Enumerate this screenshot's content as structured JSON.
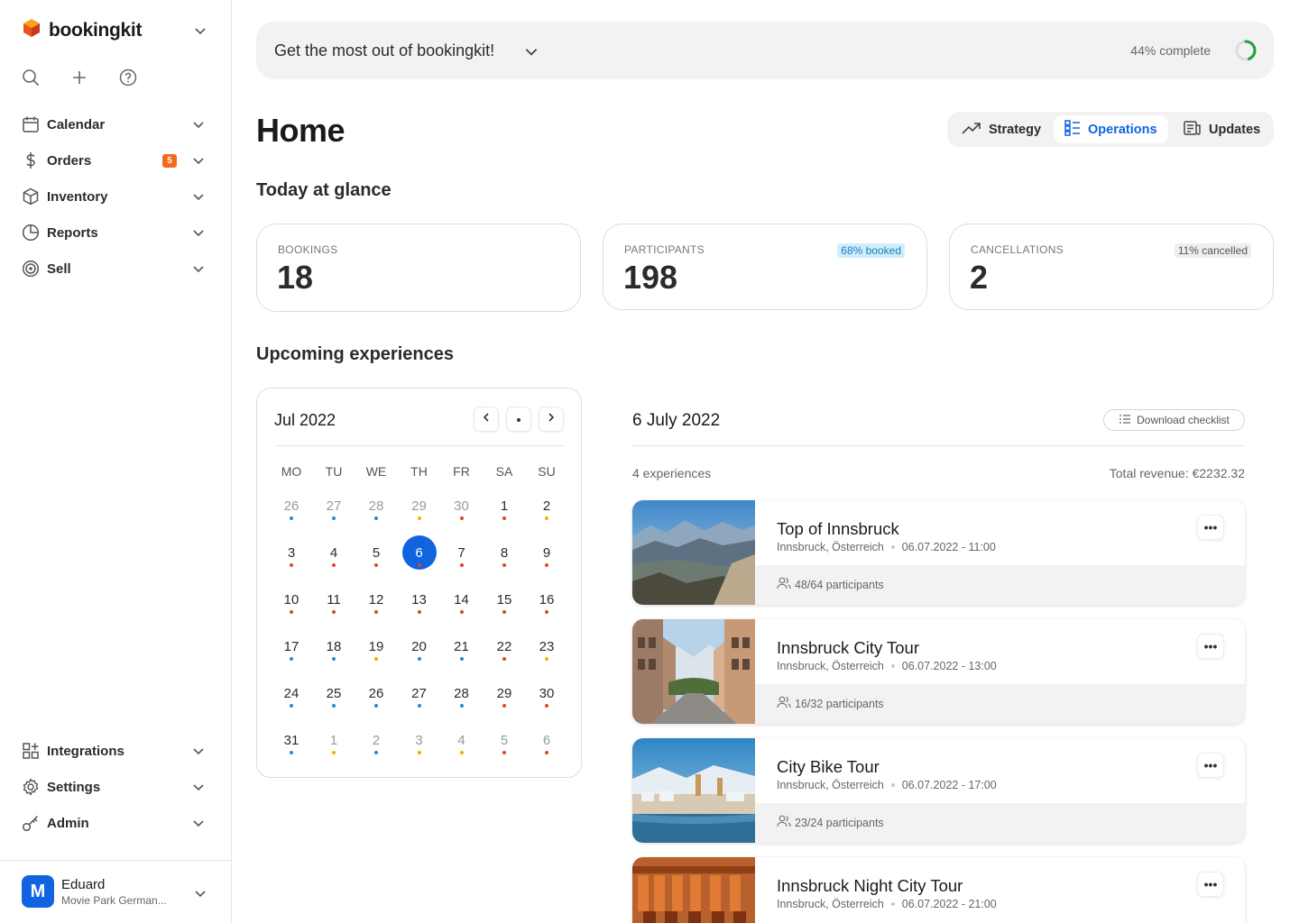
{
  "brand": {
    "name": "bookingkit"
  },
  "sidebar": {
    "top_items": [
      {
        "label": "Calendar",
        "icon": "calendar-icon"
      },
      {
        "label": "Orders",
        "icon": "dollar-icon",
        "badge": "5"
      },
      {
        "label": "Inventory",
        "icon": "box-icon"
      },
      {
        "label": "Reports",
        "icon": "pie-chart-icon"
      },
      {
        "label": "Sell",
        "icon": "target-icon"
      }
    ],
    "bottom_items": [
      {
        "label": "Integrations",
        "icon": "grid-plus-icon"
      },
      {
        "label": "Settings",
        "icon": "gear-icon"
      },
      {
        "label": "Admin",
        "icon": "key-icon"
      }
    ],
    "user": {
      "initial": "M",
      "name": "Eduard",
      "org": "Movie Park German..."
    }
  },
  "banner": {
    "title": "Get the most out of bookingkit!",
    "progress_text": "44% complete",
    "progress": 0.44
  },
  "page": {
    "title": "Home"
  },
  "view_tabs": [
    {
      "label": "Strategy",
      "active": false
    },
    {
      "label": "Operations",
      "active": true
    },
    {
      "label": "Updates",
      "active": false
    }
  ],
  "today": {
    "title": "Today at glance",
    "stats": [
      {
        "label": "BOOKINGS",
        "value": "18",
        "chip": ""
      },
      {
        "label": "PARTICIPANTS",
        "value": "198",
        "chip": "68% booked"
      },
      {
        "label": "CANCELLATIONS",
        "value": "2",
        "chip": "11% cancelled"
      }
    ]
  },
  "upcoming": {
    "title": "Upcoming experiences"
  },
  "calendar": {
    "month": "Jul 2022",
    "weekdays": [
      "MO",
      "TU",
      "WE",
      "TH",
      "FR",
      "SA",
      "SU"
    ],
    "selected": "6",
    "dot_colors": {
      "b": "#1a8fd8",
      "r": "#e0452b",
      "y": "#e8b400"
    },
    "weeks": [
      [
        {
          "d": "26",
          "m": true,
          "dot": "b"
        },
        {
          "d": "27",
          "m": true,
          "dot": "b"
        },
        {
          "d": "28",
          "m": true,
          "dot": "b"
        },
        {
          "d": "29",
          "m": true,
          "dot": "y"
        },
        {
          "d": "30",
          "m": true,
          "dot": "r"
        },
        {
          "d": "1",
          "m": false,
          "dot": "r"
        },
        {
          "d": "2",
          "m": false,
          "dot": "y"
        }
      ],
      [
        {
          "d": "3",
          "m": false,
          "dot": "r"
        },
        {
          "d": "4",
          "m": false,
          "dot": "r"
        },
        {
          "d": "5",
          "m": false,
          "dot": "r"
        },
        {
          "d": "6",
          "m": false,
          "dot": "r"
        },
        {
          "d": "7",
          "m": false,
          "dot": "r"
        },
        {
          "d": "8",
          "m": false,
          "dot": "r"
        },
        {
          "d": "9",
          "m": false,
          "dot": "r"
        }
      ],
      [
        {
          "d": "10",
          "m": false,
          "dot": "r"
        },
        {
          "d": "11",
          "m": false,
          "dot": "r"
        },
        {
          "d": "12",
          "m": false,
          "dot": "r"
        },
        {
          "d": "13",
          "m": false,
          "dot": "r"
        },
        {
          "d": "14",
          "m": false,
          "dot": "r"
        },
        {
          "d": "15",
          "m": false,
          "dot": "r"
        },
        {
          "d": "16",
          "m": false,
          "dot": "r"
        }
      ],
      [
        {
          "d": "17",
          "m": false,
          "dot": "b"
        },
        {
          "d": "18",
          "m": false,
          "dot": "b"
        },
        {
          "d": "19",
          "m": false,
          "dot": "y"
        },
        {
          "d": "20",
          "m": false,
          "dot": "b"
        },
        {
          "d": "21",
          "m": false,
          "dot": "b"
        },
        {
          "d": "22",
          "m": false,
          "dot": "r"
        },
        {
          "d": "23",
          "m": false,
          "dot": "y"
        }
      ],
      [
        {
          "d": "24",
          "m": false,
          "dot": "b"
        },
        {
          "d": "25",
          "m": false,
          "dot": "b"
        },
        {
          "d": "26",
          "m": false,
          "dot": "b"
        },
        {
          "d": "27",
          "m": false,
          "dot": "b"
        },
        {
          "d": "28",
          "m": false,
          "dot": "b"
        },
        {
          "d": "29",
          "m": false,
          "dot": "r"
        },
        {
          "d": "30",
          "m": false,
          "dot": "r"
        }
      ],
      [
        {
          "d": "31",
          "m": false,
          "dot": "b"
        },
        {
          "d": "1",
          "m": true,
          "dot": "y"
        },
        {
          "d": "2",
          "m": true,
          "dot": "b"
        },
        {
          "d": "3",
          "m": true,
          "dot": "y"
        },
        {
          "d": "4",
          "m": true,
          "dot": "y"
        },
        {
          "d": "5",
          "m": true,
          "dot": "r"
        },
        {
          "d": "6",
          "m": true,
          "dot": "r"
        }
      ]
    ]
  },
  "experiences": {
    "date": "6 July 2022",
    "download_label": "Download checklist",
    "count": "4 experiences",
    "revenue": "Total revenue: €2232.32",
    "items": [
      {
        "title": "Top of Innsbruck",
        "location": "Innsbruck, Österreich",
        "datetime": "06.07.2022 - 11:00",
        "participants": "48/64 participants",
        "image": "mountain-photo"
      },
      {
        "title": "Innsbruck City Tour",
        "location": "Innsbruck, Österreich",
        "datetime": "06.07.2022 - 13:00",
        "participants": "16/32 participants",
        "image": "street-photo"
      },
      {
        "title": "City Bike Tour",
        "location": "Innsbruck, Österreich",
        "datetime": "06.07.2022 - 17:00",
        "participants": "23/24 participants",
        "image": "winter-city-photo"
      },
      {
        "title": "Innsbruck Night City Tour",
        "location": "Innsbruck, Österreich",
        "datetime": "06.07.2022 - 21:00",
        "participants": "",
        "image": "rust-sign-photo"
      }
    ]
  },
  "colors": {
    "accent": "#1064e0",
    "badge": "#f26b1d",
    "booked_chip_bg": "#cfeefc",
    "booked_chip_text": "#1a7fb8",
    "cancelled_chip_bg": "#eeeeee",
    "progress_ring": "#1ea03a"
  }
}
